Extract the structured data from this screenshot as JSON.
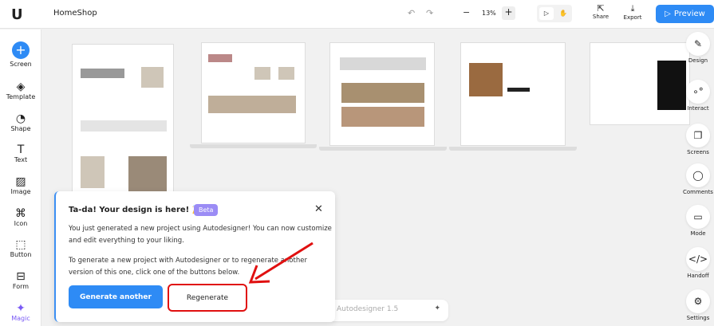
{
  "header": {
    "project_title": "HomeShop",
    "zoom": "13%",
    "share_label": "Share",
    "export_label": "Export",
    "preview_label": "Preview"
  },
  "left_sidebar": {
    "items": [
      {
        "label": "Screen",
        "icon": "plus-icon"
      },
      {
        "label": "Template",
        "icon": "layers-icon"
      },
      {
        "label": "Shape",
        "icon": "shape-icon"
      },
      {
        "label": "Text",
        "icon": "text-icon"
      },
      {
        "label": "Image",
        "icon": "image-icon"
      },
      {
        "label": "Icon",
        "icon": "icon-icon"
      },
      {
        "label": "Button",
        "icon": "cursor-icon"
      },
      {
        "label": "Form",
        "icon": "form-icon"
      },
      {
        "label": "Magic",
        "icon": "sparkle-icon"
      }
    ]
  },
  "right_sidebar": {
    "items": [
      {
        "label": "Design",
        "icon": "pencil-icon"
      },
      {
        "label": "Interact",
        "icon": "link-icon"
      },
      {
        "label": "Screens",
        "icon": "screens-icon"
      },
      {
        "label": "Comments",
        "icon": "comment-icon"
      },
      {
        "label": "Mode",
        "icon": "monitor-icon"
      },
      {
        "label": "Handoff",
        "icon": "code-icon"
      },
      {
        "label": "Settings",
        "icon": "gear-icon"
      }
    ]
  },
  "dialog": {
    "title": "Ta-da! Your design is here! 🎉",
    "badge": "Beta",
    "para1": "You just generated a new project using Autodesigner! You can now customize and edit everything to your liking.",
    "para2": "To generate a new project with Autodesigner or to regenerate another version of this one, click one of the buttons below.",
    "generate_label": "Generate another",
    "regenerate_label": "Regenerate"
  },
  "autodesigner": {
    "label": "Autodesigner 1.5"
  },
  "colors": {
    "accent": "#2e8bf5",
    "highlight": "#e01010",
    "beta": "#9b8cf5"
  }
}
